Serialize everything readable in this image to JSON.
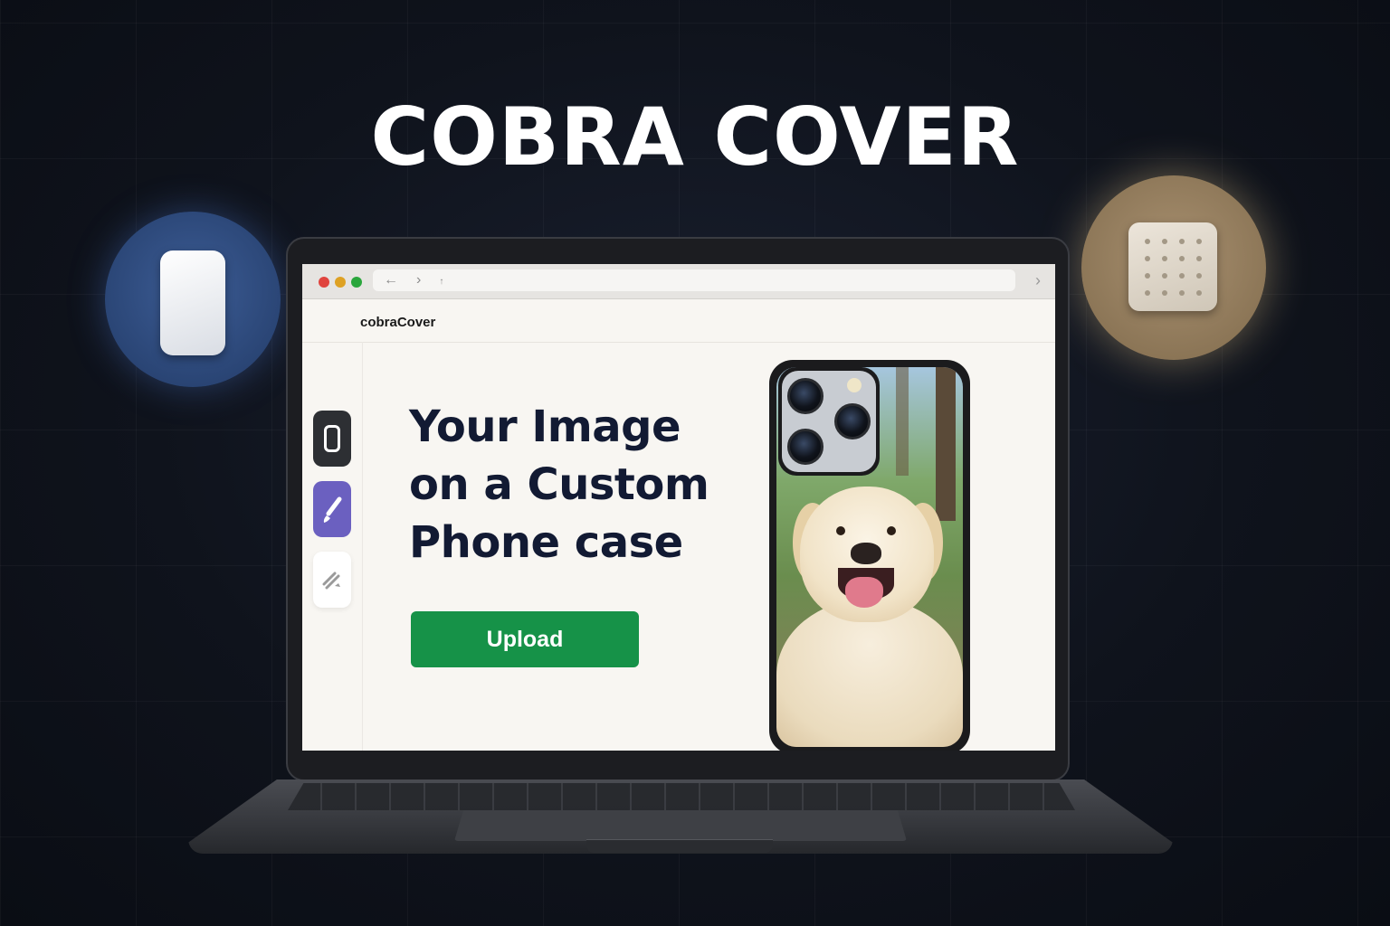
{
  "hero": {
    "title": "COBRA COVER"
  },
  "browser": {
    "back_icon": "←",
    "forward_icon": "›",
    "refresh_icon": "↑",
    "next_icon": "›"
  },
  "site": {
    "brand": "cobraCover",
    "headline_line1": "Your Image",
    "headline_line2": "on a Custom",
    "headline_line3": "Phone case",
    "upload_label": "Upload"
  },
  "colors": {
    "upload_button": "#169248",
    "headline": "#121a33",
    "brush_tool": "#6b60c0",
    "case_tool": "#2d2f33"
  },
  "icons": [
    "phone-case-icon",
    "grid-pattern-icon",
    "brush-icon",
    "eraser-icon"
  ]
}
